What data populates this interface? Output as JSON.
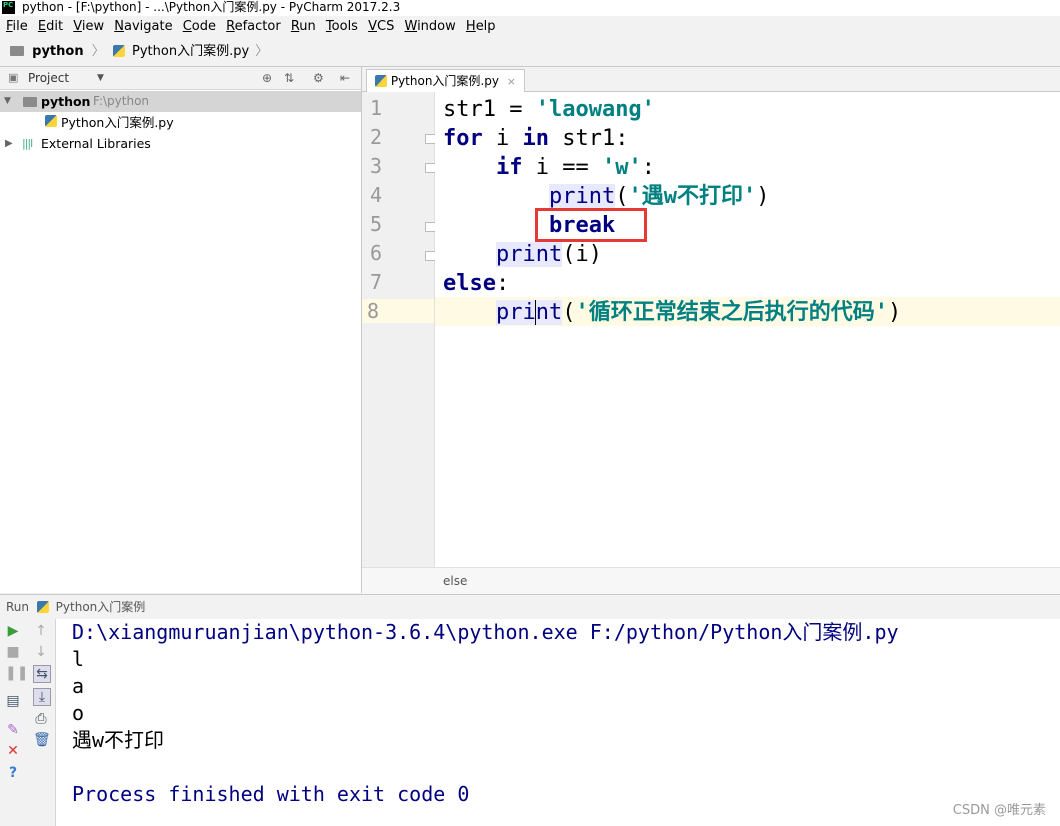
{
  "window": {
    "title": "python - [F:\\python] - ...\\Python入门案例.py - PyCharm 2017.2.3",
    "logo": "PC"
  },
  "menu": [
    "File",
    "Edit",
    "View",
    "Navigate",
    "Code",
    "Refactor",
    "Run",
    "Tools",
    "VCS",
    "Window",
    "Help"
  ],
  "navbar": {
    "project": "python",
    "file": "Python入门案例.py"
  },
  "project_panel": {
    "header": "Project",
    "root": {
      "name": "python",
      "path": "F:\\python"
    },
    "file": "Python入门案例.py",
    "external": "External Libraries"
  },
  "editor": {
    "tab": "Python入门案例.py",
    "line_numbers": [
      "1",
      "2",
      "3",
      "4",
      "5",
      "6",
      "7",
      "8"
    ],
    "breadcrumb": "else",
    "highlight_color": "#e53935"
  },
  "run_panel": {
    "header_label": "Run",
    "config": "Python入门案例",
    "console": [
      "D:\\xiangmuruanjian\\python-3.6.4\\python.exe F:/python/Python入门案例.py",
      "l",
      "a",
      "o",
      "遇w不打印",
      "",
      "Process finished with exit code 0"
    ]
  },
  "watermark": "CSDN @唯元素"
}
